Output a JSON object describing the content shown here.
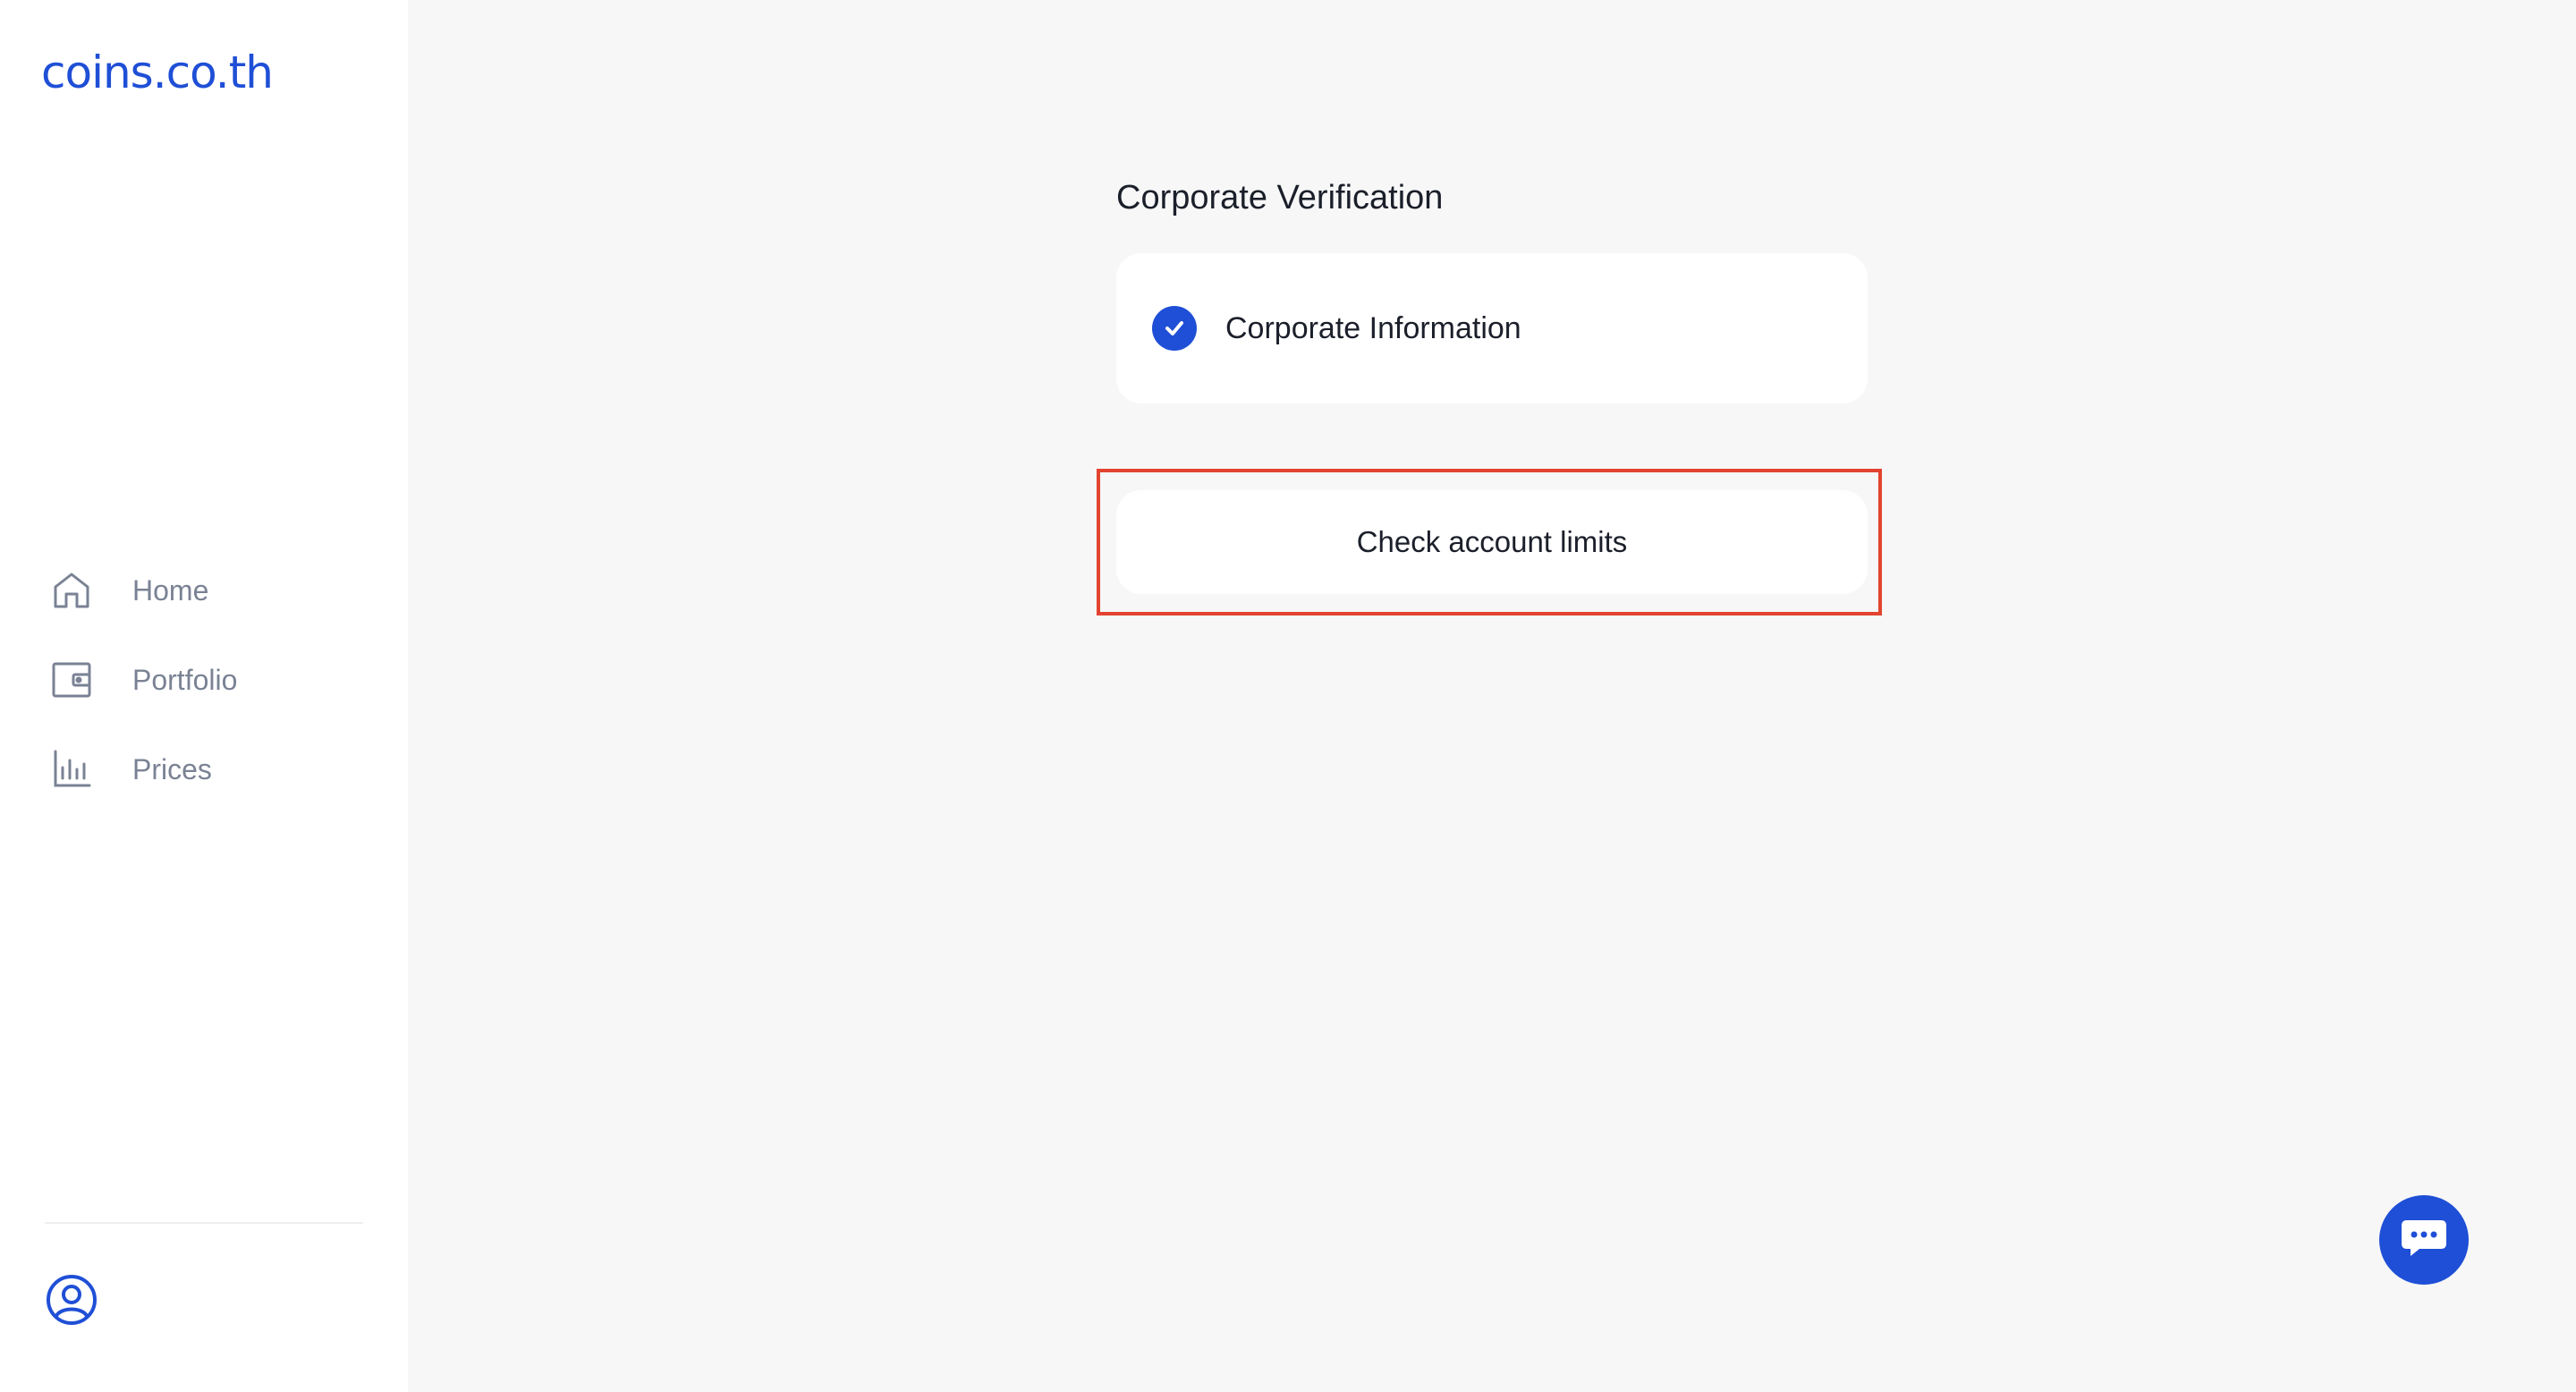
{
  "brand": {
    "logo_text": "coins.co.th",
    "color": "#1f4fd6"
  },
  "sidebar": {
    "items": [
      {
        "label": "Home",
        "icon": "home-icon"
      },
      {
        "label": "Portfolio",
        "icon": "wallet-icon"
      },
      {
        "label": "Prices",
        "icon": "bar-chart-icon"
      }
    ],
    "profile_icon": "user-circle-icon"
  },
  "main": {
    "title": "Corporate Verification",
    "steps": [
      {
        "label": "Corporate Information",
        "status": "completed",
        "icon": "check-circle-icon"
      }
    ],
    "limits_button_label": "Check account limits"
  },
  "chat": {
    "icon": "chat-bubble-icon"
  },
  "colors": {
    "accent": "#1f4fd6",
    "highlight": "#e2442f",
    "muted_text": "#7a8294"
  }
}
